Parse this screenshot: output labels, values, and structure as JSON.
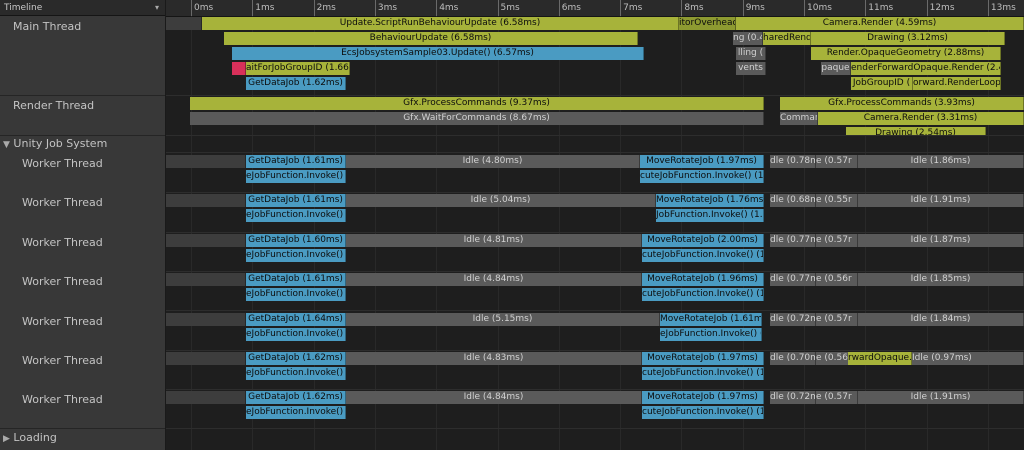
{
  "header": {
    "title": "Timeline"
  },
  "ruler": {
    "ticks": [
      "0ms",
      "1ms",
      "2ms",
      "3ms",
      "4ms",
      "5ms",
      "6ms",
      "7ms",
      "8ms",
      "9ms",
      "10ms",
      "11ms",
      "12ms",
      "13ms"
    ]
  },
  "threads": {
    "main": "Main Thread",
    "render": "Render Thread",
    "jobsystem": "Unity Job System",
    "worker": "Worker Thread",
    "loading": "Loading"
  },
  "main_thread": {
    "row1": [
      "Update.ScriptRunBehaviourUpdate (6.58ms)",
      "itorOverhead (1.27ms",
      "Camera.Render (4.59ms)"
    ],
    "row2": [
      "BehaviourUpdate (6.58ms)",
      "ng (0.4",
      "haredRend",
      "Drawing (3.12ms)"
    ],
    "row3": [
      "EcsJobsystemSample03.Update() (6.57ms)",
      "lling (",
      "Render.OpaqueGeometry (2.88ms)"
    ],
    "row4": [
      "aitForJobGroupID (1.66m",
      "vents",
      "paque",
      "enderForwardOpaque.Render (2.40m"
    ],
    "row5": [
      "GetDataJob (1.62ms)",
      "JobGroupID (",
      "orward.RenderLoopJob"
    ]
  },
  "render_thread": {
    "row1": [
      "Gfx.ProcessCommands (9.37ms)",
      "Gfx.ProcessCommands (3.93ms)"
    ],
    "row2": [
      "Gfx.WaitForCommands (8.67ms)",
      "Comman",
      "Camera.Render (3.31ms)"
    ],
    "row3": [
      "Drawing (2.54ms)"
    ]
  },
  "workers": [
    {
      "job": "GetDataJob (1.61ms)",
      "exec": "eJobFunction.Invoke() (1",
      "idle": "Idle (4.80ms)",
      "move": "MoveRotateJob (1.97ms)",
      "mexec": "cuteJobFunction.Invoke() (1.96",
      "s1": "dle (0.78ms",
      "s2": "e (0.57r",
      "idle2": "Idle (1.86ms)"
    },
    {
      "job": "GetDataJob (1.61ms)",
      "exec": "eJobFunction.Invoke() (1",
      "idle": "Idle (5.04ms)",
      "move": "MoveRotateJob (1.76ms)",
      "mexec": "JobFunction.Invoke() (1.7",
      "s1": "dle (0.68m",
      "s2": "e (0.55r",
      "idle2": "Idle (1.91ms)"
    },
    {
      "job": "GetDataJob (1.60ms)",
      "exec": "eJobFunction.Invoke() (1",
      "idle": "Idle (4.81ms)",
      "move": "MoveRotateJob (2.00ms)",
      "mexec": "cuteJobFunction.Invoke() (1.99",
      "s1": "dle (0.77ms",
      "s2": "e (0.57r",
      "idle2": "Idle (1.87ms)"
    },
    {
      "job": "GetDataJob (1.61ms)",
      "exec": "eJobFunction.Invoke() (1",
      "idle": "Idle (4.84ms)",
      "move": "MoveRotateJob (1.96ms)",
      "mexec": "cuteJobFunction.Invoke() (1.95",
      "s1": "dle (0.77ms",
      "s2": "e (0.56r",
      "idle2": "Idle (1.85ms)"
    },
    {
      "job": "GetDataJob (1.64ms)",
      "exec": "eJobFunction.Invoke() (1",
      "idle": "Idle (5.15ms)",
      "move": "MoveRotateJob (1.61ms)",
      "mexec": "eJobFunction.Invoke() (1",
      "s1": "dle (0.72ms",
      "s2": "e (0.57r",
      "idle2": "Idle (1.84ms)"
    },
    {
      "job": "GetDataJob (1.62ms)",
      "exec": "eJobFunction.Invoke() (1",
      "idle": "Idle (4.83ms)",
      "move": "MoveRotateJob (1.97ms)",
      "mexec": "cuteJobFunction.Invoke() (1.97",
      "s1": "dle (0.70ms",
      "s2": "e (0.56r",
      "s3": "rwardOpaque.So",
      "idle2": "Idle (0.97ms)"
    },
    {
      "job": "GetDataJob (1.62ms)",
      "exec": "eJobFunction.Invoke() (1",
      "idle": "Idle (4.84ms)",
      "move": "MoveRotateJob (1.97ms)",
      "mexec": "cuteJobFunction.Invoke() (1.97",
      "s1": "dle (0.72ms",
      "s2": "e (0.57r",
      "idle2": "Idle (1.91ms)"
    }
  ],
  "colors": {
    "script": "#a7b33a",
    "job": "#4a9bc2",
    "idle": "#5a5a5a",
    "wait": "#d8305a"
  }
}
